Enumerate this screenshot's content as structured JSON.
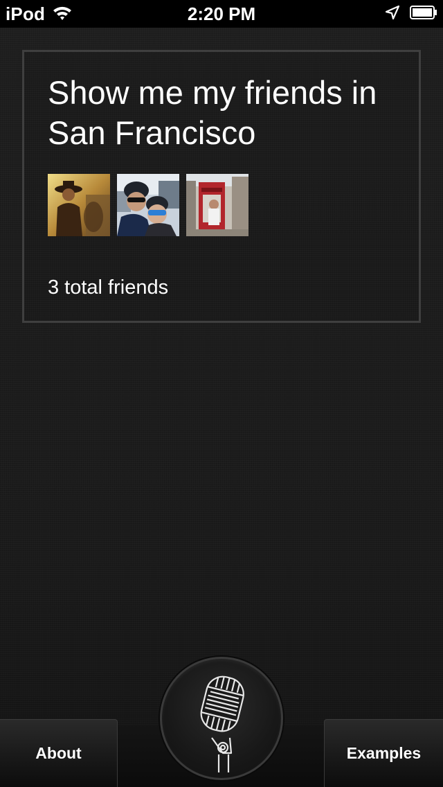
{
  "status_bar": {
    "carrier": "iPod",
    "time": "2:20 PM",
    "icons": [
      "wifi-icon",
      "location-arrow-icon",
      "battery-icon"
    ]
  },
  "result": {
    "query": "Show me my friends in San Francisco",
    "photos": [
      {
        "name": "friend-photo-1"
      },
      {
        "name": "friend-photo-2"
      },
      {
        "name": "friend-photo-3"
      }
    ],
    "summary": "3 total friends"
  },
  "toolbar": {
    "about_label": "About",
    "examples_label": "Examples",
    "mic_icon": "microphone-icon"
  },
  "colors": {
    "background": "#1d1d1d",
    "card_border": "#3f3f3f",
    "text": "#ffffff"
  }
}
